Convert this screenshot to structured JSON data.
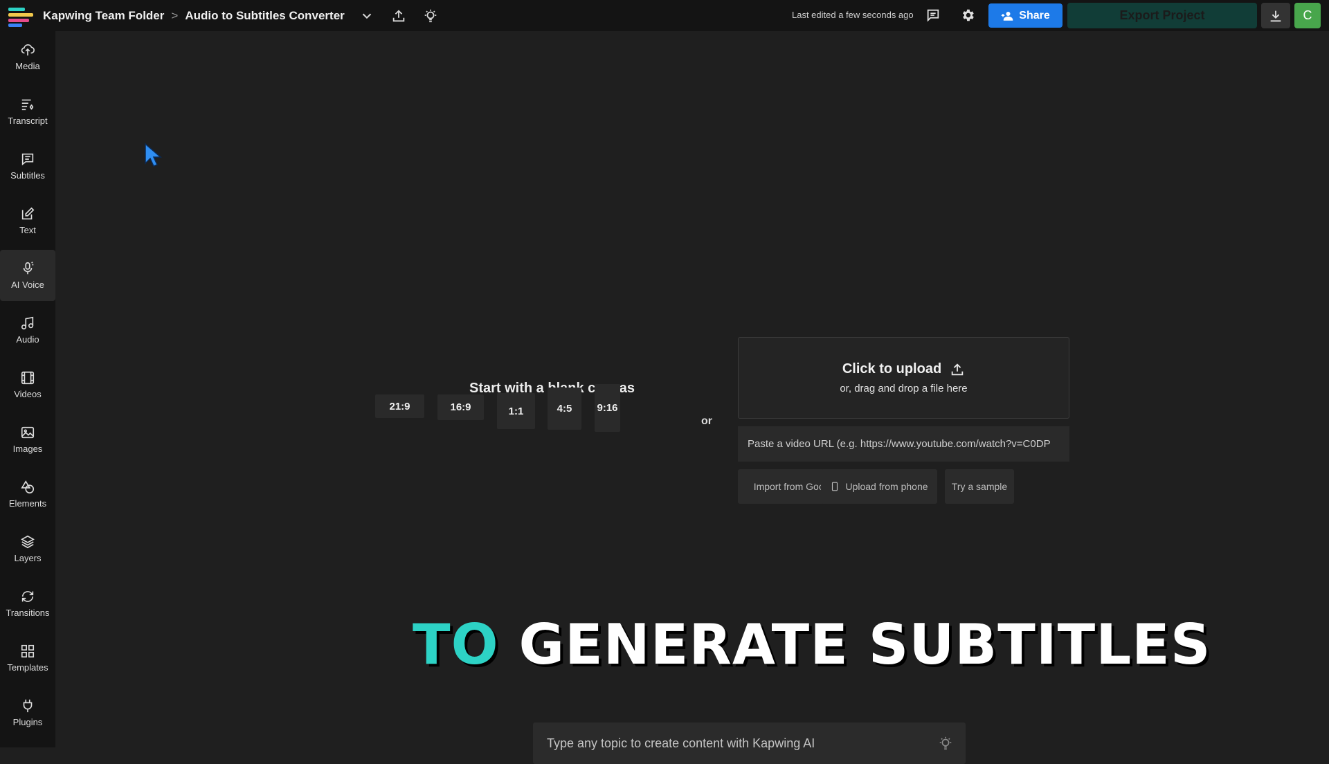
{
  "header": {
    "team_folder": "Kapwing Team Folder",
    "separator": ">",
    "project_name": "Audio to Subtitles Converter",
    "last_edited": "Last edited a few seconds ago",
    "share_label": "Share",
    "export_label": "Export Project",
    "avatar_initial": "C"
  },
  "sidebar": {
    "items": [
      {
        "label": "Media",
        "icon": "upload-cloud-icon"
      },
      {
        "label": "Transcript",
        "icon": "transcript-icon"
      },
      {
        "label": "Subtitles",
        "icon": "subtitles-icon"
      },
      {
        "label": "Text",
        "icon": "text-edit-icon"
      },
      {
        "label": "AI Voice",
        "icon": "ai-voice-icon"
      },
      {
        "label": "Audio",
        "icon": "music-note-icon"
      },
      {
        "label": "Videos",
        "icon": "film-icon"
      },
      {
        "label": "Images",
        "icon": "image-icon"
      },
      {
        "label": "Elements",
        "icon": "shapes-icon"
      },
      {
        "label": "Layers",
        "icon": "layers-icon"
      },
      {
        "label": "Transitions",
        "icon": "transitions-icon"
      },
      {
        "label": "Templates",
        "icon": "grid-icon"
      },
      {
        "label": "Plugins",
        "icon": "plug-icon"
      }
    ],
    "active": "AI Voice"
  },
  "canvas": {
    "blank_title": "Start with a blank canvas",
    "ratios": [
      "21:9",
      "16:9",
      "1:1",
      "4:5",
      "9:16"
    ],
    "or_label": "or",
    "upload_title": "Click to upload",
    "upload_sub": "or, drag and drop a file here",
    "url_placeholder": "Paste a video URL (e.g. https://www.youtube.com/watch?v=C0DP",
    "import_google": "Import from Google",
    "upload_phone": "Upload from phone",
    "try_sample": "Try a sample"
  },
  "caption": {
    "highlight": "TO",
    "rest": "GENERATE SUBTITLES",
    "highlight_color": "#2dd2c5"
  },
  "ai_bar": {
    "placeholder": "Type any topic to create content with Kapwing AI"
  },
  "colors": {
    "share": "#1d7ae8",
    "export": "#113d37",
    "avatar": "#48a64c",
    "background": "#1f1f1f",
    "sidebar": "#141414"
  }
}
